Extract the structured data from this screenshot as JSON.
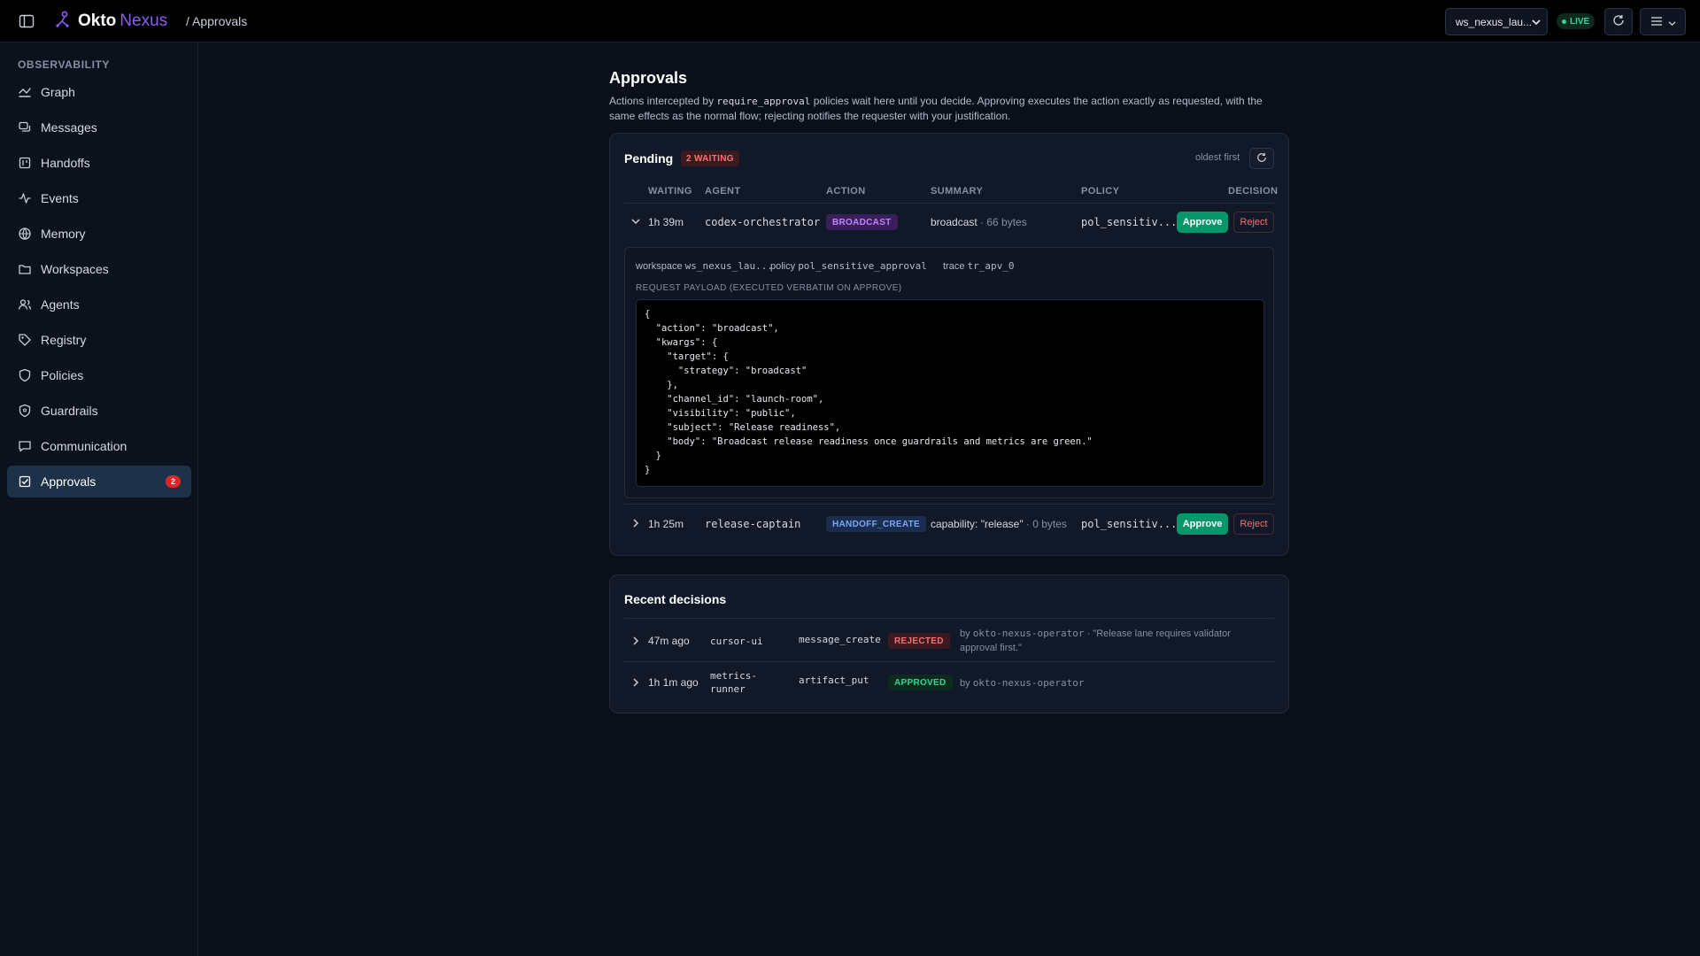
{
  "header": {
    "brand_name": "Okto",
    "brand_accent": "Nexus",
    "breadcrumb": "/ Approvals",
    "workspace_select": "ws_nexus_lau...",
    "live_label": "LIVE",
    "colors": {
      "accent": "#8b5cf6",
      "live": "#34d399"
    }
  },
  "sidebar": {
    "section_label": "OBSERVABILITY",
    "items": [
      {
        "label": "Graph",
        "icon": "graph-icon"
      },
      {
        "label": "Messages",
        "icon": "messages-icon"
      },
      {
        "label": "Handoffs",
        "icon": "handoffs-icon"
      },
      {
        "label": "Events",
        "icon": "events-icon"
      },
      {
        "label": "Memory",
        "icon": "memory-icon"
      },
      {
        "label": "Workspaces",
        "icon": "folder-icon"
      },
      {
        "label": "Agents",
        "icon": "users-icon"
      },
      {
        "label": "Registry",
        "icon": "tag-icon"
      },
      {
        "label": "Policies",
        "icon": "shield-icon"
      },
      {
        "label": "Guardrails",
        "icon": "shield-check-icon"
      },
      {
        "label": "Communication",
        "icon": "chat-icon"
      },
      {
        "label": "Approvals",
        "icon": "check-square-icon",
        "badge": "2",
        "active": true
      }
    ]
  },
  "main": {
    "title": "Approvals",
    "desc_pre": "Actions intercepted by ",
    "desc_code": "require_approval",
    "desc_post": " policies wait here until you decide. Approving executes the action exactly as requested, with the same effects as the normal flow; rejecting notifies the requester with your justification."
  },
  "pending": {
    "title": "Pending",
    "badge": "2 WAITING",
    "sort_label": "oldest first",
    "columns": [
      "WAITING",
      "AGENT",
      "ACTION",
      "SUMMARY",
      "POLICY",
      "DECISION"
    ],
    "rows": [
      {
        "waiting": "1h 39m",
        "agent": "codex-orchestrator",
        "action": "BROADCAST",
        "summary_main": "broadcast",
        "summary_sub": " · 66 bytes",
        "policy": "pol_sensitiv...",
        "approve": "Approve",
        "reject": "Reject",
        "expanded": true
      },
      {
        "waiting": "1h 25m",
        "agent": "release-captain",
        "action": "HANDOFF_CREATE",
        "summary_main": "capability: \"release\"",
        "summary_sub": " · 0 bytes",
        "policy": "pol_sensitiv...",
        "approve": "Approve",
        "reject": "Reject",
        "expanded": false
      }
    ],
    "detail": {
      "workspace_label": "workspace",
      "workspace_value": "ws_nexus_lau...",
      "policy_label": "policy",
      "policy_value": "pol_sensitive_approval",
      "trace_label": "trace",
      "trace_value": "tr_apv_0",
      "payload_label": "REQUEST PAYLOAD (EXECUTED VERBATIM ON APPROVE)",
      "payload": "{\n  \"action\": \"broadcast\",\n  \"kwargs\": {\n    \"target\": {\n      \"strategy\": \"broadcast\"\n    },\n    \"channel_id\": \"launch-room\",\n    \"visibility\": \"public\",\n    \"subject\": \"Release readiness\",\n    \"body\": \"Broadcast release readiness once guardrails and metrics are green.\"\n  }\n}"
    }
  },
  "recent": {
    "title": "Recent decisions",
    "rows": [
      {
        "time": "47m ago",
        "agent": "cursor-ui",
        "action": "message_create",
        "status": "REJECTED",
        "by_prefix": "by ",
        "by": "okto-nexus-operator",
        "note": " · \"Release lane requires validator approval first.\""
      },
      {
        "time": "1h 1m ago",
        "agent": "metrics-runner",
        "action": "artifact_put",
        "status": "APPROVED",
        "by_prefix": "by ",
        "by": "okto-nexus-operator",
        "note": ""
      }
    ]
  }
}
